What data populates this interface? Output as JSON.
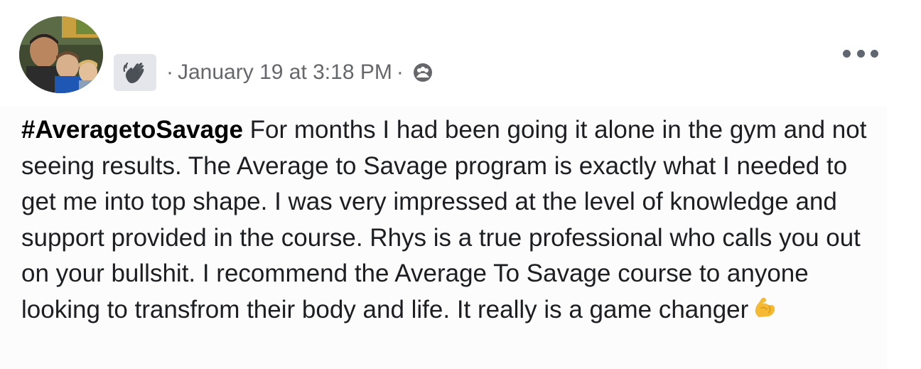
{
  "post": {
    "header": {
      "avatar_icon": "profile-photo",
      "badge_icon": "wave-hand-icon",
      "separator": "·",
      "timestamp": "January 19 at 3:18 PM",
      "privacy_icon": "group-icon",
      "more_icon": "more-options-icon"
    },
    "body": {
      "hashtag": "#AveragetoSavage",
      "text": "For months I had been going it alone in the gym and not seeing results. The Average to Savage program is exactly what I needed to get me into top shape. I was very impressed at the level of knowledge and support provided in the course. Rhys is a true professional who calls you out on your bullshit. I recommend the Average To Savage course to anyone looking to transfrom their body and life. It really is a game changer",
      "emoji_icon": "flexed-biceps-icon"
    }
  }
}
